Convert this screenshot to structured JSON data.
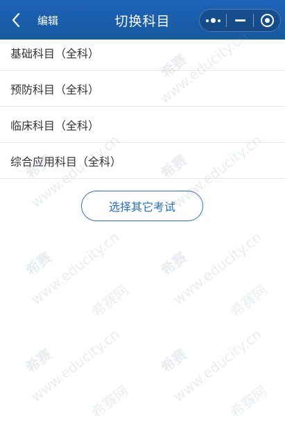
{
  "navbar": {
    "back_icon": "chevron-left-icon",
    "edit_label": "编辑",
    "title": "切换科目",
    "capsule_icons": [
      "more-dots-icon",
      "minimize-icon",
      "close-target-icon"
    ],
    "background_color": "#1a5fb4"
  },
  "subjects": [
    {
      "label": "基础科目（全科）"
    },
    {
      "label": "预防科目（全科）"
    },
    {
      "label": "临床科目（全科）"
    },
    {
      "label": "综合应用科目（全科）"
    }
  ],
  "other_exam_button": {
    "label": "选择其它考试",
    "color": "#2a6db5"
  },
  "watermark": {
    "brand": "希赛",
    "domain": "www.educity.cn",
    "brand_net": "希赛网"
  }
}
